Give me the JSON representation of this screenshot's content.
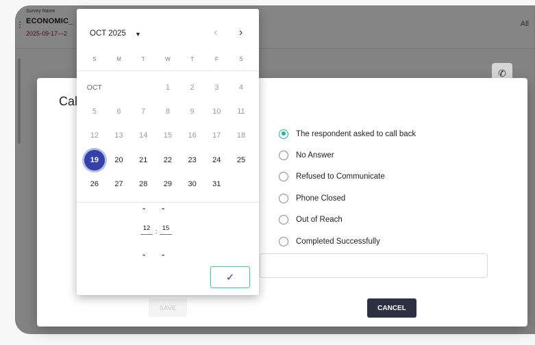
{
  "header": {
    "survey_label": "Survey Name",
    "survey_name": "ECONOMIC_",
    "survey_date": "2025-09-17—2",
    "all_label": "All"
  },
  "dialog": {
    "title": "Cal",
    "options": [
      {
        "label": "The respondent asked to call back",
        "selected": true
      },
      {
        "label": "No Answer",
        "selected": false
      },
      {
        "label": "Refused to Communicate",
        "selected": false
      },
      {
        "label": "Phone Closed",
        "selected": false
      },
      {
        "label": "Out of Reach",
        "selected": false
      },
      {
        "label": "Completed Successfully",
        "selected": false
      }
    ],
    "save_label": "SAVE",
    "cancel_label": "CANCEL",
    "accent_color": "#1fb59a"
  },
  "datepicker": {
    "month_label": "OCT 2025",
    "weekdays": [
      "S",
      "M",
      "T",
      "W",
      "T",
      "F",
      "S"
    ],
    "month_short": "OCT",
    "days": [
      [
        "OCT",
        "",
        "",
        "1",
        "2",
        "3",
        "4"
      ],
      [
        "5",
        "6",
        "7",
        "8",
        "9",
        "10",
        "11"
      ],
      [
        "12",
        "13",
        "14",
        "15",
        "16",
        "17",
        "18"
      ],
      [
        "19",
        "20",
        "21",
        "22",
        "23",
        "24",
        "25"
      ],
      [
        "26",
        "27",
        "28",
        "29",
        "30",
        "31",
        ""
      ]
    ],
    "selected_day": "19",
    "hour": "12",
    "minute": "15",
    "time_separator": ":",
    "selected_color": "#3341a8",
    "confirm_icon": "check-icon"
  }
}
